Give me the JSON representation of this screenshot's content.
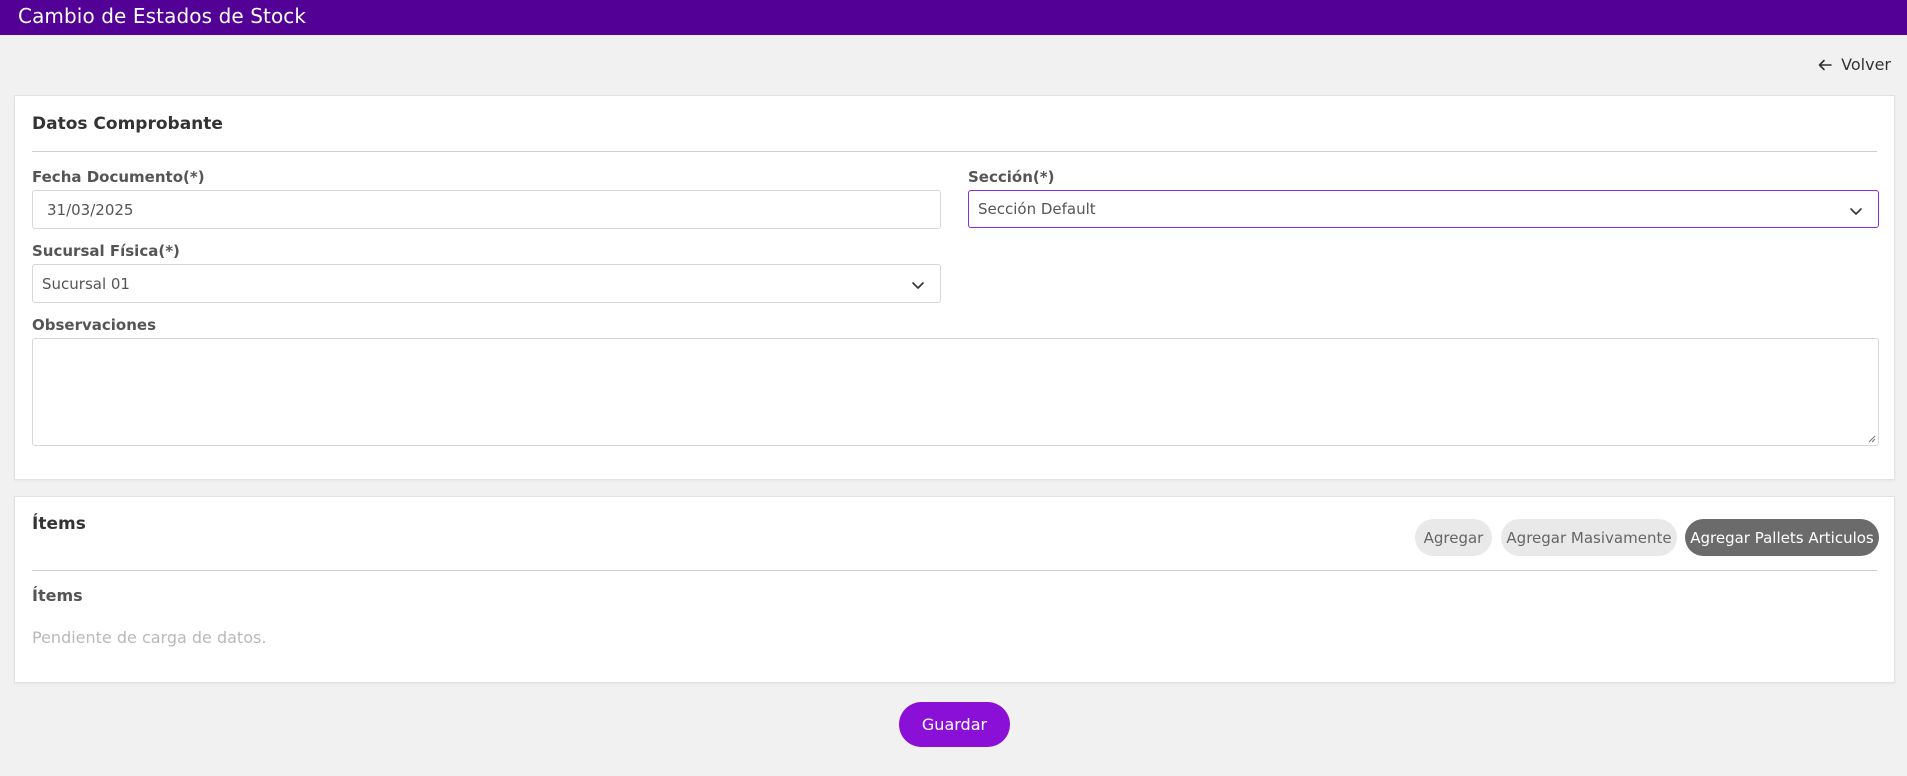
{
  "header": {
    "title": "Cambio de Estados de Stock"
  },
  "nav": {
    "back_label": "Volver",
    "back_icon": "arrow-left-icon"
  },
  "comprobante": {
    "title": "Datos Comprobante",
    "fecha": {
      "label": "Fecha Documento(*)",
      "value": "31/03/2025"
    },
    "seccion": {
      "label": "Sección(*)",
      "value": "Sección Default"
    },
    "sucursal": {
      "label": "Sucursal Física(*)",
      "value": "Sucursal 01"
    },
    "observaciones": {
      "label": "Observaciones",
      "value": ""
    }
  },
  "items": {
    "title": "Ítems",
    "buttons": {
      "agregar": "Agregar",
      "masivo": "Agregar Masivamente",
      "pallets": "Agregar Pallets Articulos"
    },
    "list_label": "Ítems",
    "empty_text": "Pendiente de carga de datos."
  },
  "footer": {
    "save_label": "Guardar"
  },
  "colors": {
    "header_bg": "#520096",
    "accent": "#8a10d8",
    "focus_border": "#8a2be2",
    "dark_button": "#6b6b6b"
  }
}
